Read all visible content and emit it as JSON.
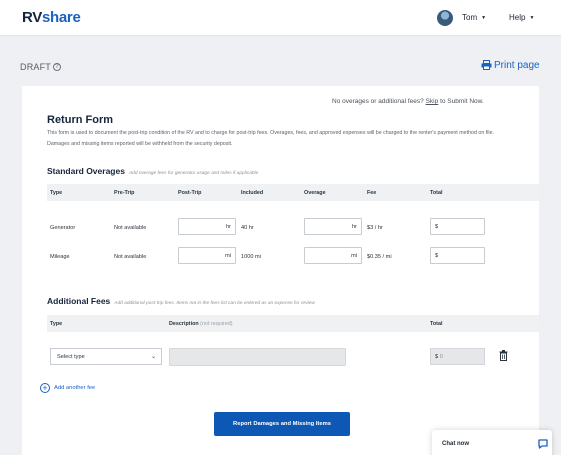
{
  "header": {
    "logo_part1": "RV",
    "logo_part2": "share",
    "user_name": "Tom",
    "help_label": "Help"
  },
  "status": {
    "draft_label": "DRAFT",
    "print_label": "Print page"
  },
  "form": {
    "no_overages_prefix": "No overages or additional fees?",
    "skip_label": "Skip",
    "no_overages_suffix": "to Submit Now.",
    "title": "Return Form",
    "description": "This form is used to document the post-trip condition of the RV and to charge for post-trip fees. Overages, fees, and approved expenses will be charged to the renter's payment method on file. Damages and missing items reported will be withheld from the security deposit."
  },
  "standard_overages": {
    "title": "Standard Overages",
    "subtitle": "Add overage fees for generator usage and miles if applicable",
    "columns": [
      "Type",
      "Pre-Trip",
      "Post-Trip",
      "Included",
      "Overage",
      "Fee",
      "Total"
    ],
    "rows": [
      {
        "type": "Generator",
        "pre_trip": "Not available",
        "post_unit": "hr",
        "included": "40 hr",
        "overage_unit": "hr",
        "fee": "$3 / hr",
        "total_prefix": "$"
      },
      {
        "type": "Mileage",
        "pre_trip": "Not available",
        "post_unit": "mi",
        "included": "1000 mi",
        "overage_unit": "mi",
        "fee": "$0.35 / mi",
        "total_prefix": "$"
      }
    ]
  },
  "additional_fees": {
    "title": "Additional Fees",
    "subtitle": "Add additional post-trip fees. Items not in the fees list can be entered as an expense for review",
    "col_type": "Type",
    "col_description": "Description",
    "col_description_note": "(not required)",
    "col_total": "Total",
    "select_value": "Select type",
    "total_prefix": "$",
    "total_value": "0",
    "add_label": "Add another fee"
  },
  "actions": {
    "report_label": "Report Damages and Missing Items"
  },
  "chat": {
    "label": "Chat now"
  },
  "colors": {
    "brand_blue": "#1a62c2",
    "button_blue": "#0d57b5",
    "navy": "#15253b",
    "background": "#eef0f3"
  }
}
